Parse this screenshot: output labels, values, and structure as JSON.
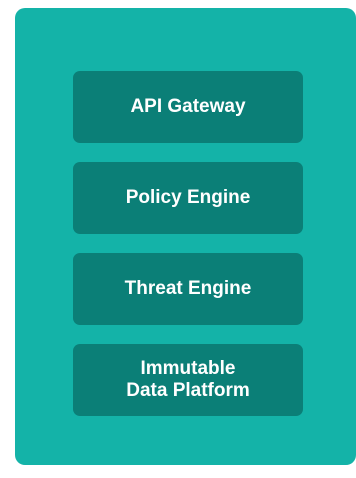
{
  "colors": {
    "panel": "#14b3a8",
    "block": "#0b7f77",
    "text": "#ffffff"
  },
  "stack": {
    "blocks": [
      {
        "label": "API Gateway"
      },
      {
        "label": "Policy Engine"
      },
      {
        "label": "Threat Engine"
      },
      {
        "label": "Immutable\nData Platform"
      }
    ]
  }
}
